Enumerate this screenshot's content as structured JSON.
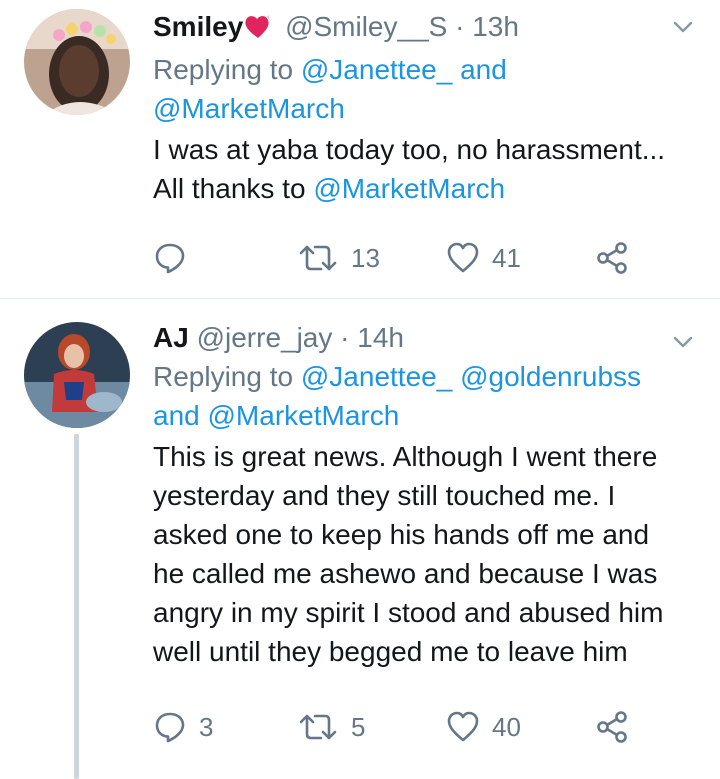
{
  "tweets": [
    {
      "name": "Smiley",
      "handle": "@Smiley__S",
      "dot": "·",
      "time": "13h",
      "replying_prefix": "Replying to",
      "replying_mentions": [
        "@Janettee_",
        "@MarketMarch"
      ],
      "replying_joiner": "and",
      "text_line1": "I was at yaba today too, no harassment...",
      "text_line2_prefix": "All thanks to",
      "text_line2_mention": "@MarketMarch",
      "replies": "",
      "retweets": "13",
      "likes": "41",
      "icons": {
        "reply": "reply-icon",
        "retweet": "retweet-icon",
        "like": "heart-icon",
        "share": "share-icon",
        "menu": "chevron-down-icon",
        "emoji": "heart-emoji-icon"
      }
    },
    {
      "name": "AJ",
      "handle": "@jerre_jay",
      "dot": "·",
      "time": "14h",
      "replying_prefix": "Replying to",
      "replying_mentions": [
        "@Janettee_",
        "@goldenrubss",
        "@MarketMarch"
      ],
      "replying_joiner": "and",
      "text": "This is great news. Although I went there yesterday and they still touched me. I asked one to keep his hands off me and he called me ashewo and because I was angry in my spirit I stood and abused him well until they begged me to leave him",
      "replies": "3",
      "retweets": "5",
      "likes": "40"
    }
  ],
  "colors": {
    "link": "#1b95e0",
    "muted": "#657786",
    "divider": "#e6ecf0",
    "thread": "#ccd6dd"
  }
}
